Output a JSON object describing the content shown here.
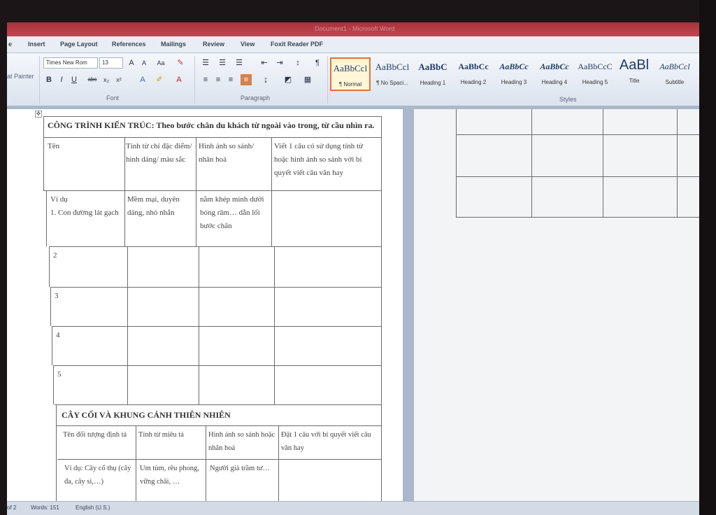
{
  "app": {
    "title": "Document1 - Microsoft Word"
  },
  "tabs": [
    "e",
    "Insert",
    "Page Layout",
    "References",
    "Mailings",
    "Review",
    "View",
    "Foxit Reader PDF"
  ],
  "ribbon": {
    "clipboard_label": "at Painter",
    "font_name": "Times New Rom",
    "font_size": "13",
    "font_group_label": "Font",
    "paragraph_group_label": "Paragraph",
    "styles_group_label": "Styles",
    "styles": [
      {
        "preview": "AaBbCcl",
        "name": "¶ Normal",
        "active": true
      },
      {
        "preview": "AaBbCcl",
        "name": "¶ No Spaci...",
        "active": false
      },
      {
        "preview": "AaBbC",
        "name": "Heading 1",
        "active": false
      },
      {
        "preview": "AaBbCc",
        "name": "Heading 2",
        "active": false
      },
      {
        "preview": "AaBbCc",
        "name": "Heading 3",
        "active": false
      },
      {
        "preview": "AaBbCc",
        "name": "Heading 4",
        "active": false
      },
      {
        "preview": "AaBbCcC",
        "name": "Heading 5",
        "active": false
      },
      {
        "preview": "AaBl",
        "name": "Title",
        "active": false
      },
      {
        "preview": "AaBbCcl",
        "name": "Subtitle",
        "active": false
      }
    ]
  },
  "document": {
    "section1_title": "CÔNG TRÌNH KIẾN TRÚC: Theo bước chân du khách từ ngoài vào trong, từ cầu nhìn ra.",
    "table1_headers": [
      "Tên",
      "Tính từ chỉ đặc điểm/ hình dáng/ màu sắc",
      "Hình ảnh so sánh/ nhân hoá",
      "Viết 1 câu có sử dụng tính từ hoặc hình ảnh so sánh với bí quyết viết câu văn hay"
    ],
    "table1_rows": [
      [
        "Ví dụ\n1. Con đường lát gạch",
        "Mềm mại, duyên dáng, nhỏ nhắn",
        "nằm khép mình dưới bóng râm… dẫn lối bước chân",
        ""
      ],
      [
        "2",
        "",
        "",
        ""
      ],
      [
        "3",
        "",
        "",
        ""
      ],
      [
        "4",
        "",
        "",
        ""
      ],
      [
        "5",
        "",
        "",
        ""
      ]
    ],
    "section2_title": "CÂY CỐI VÀ KHUNG CẢNH THIÊN NHIÊN",
    "table2_headers": [
      "Tên đối tượng định tả",
      "Tính từ miêu tả",
      "Hình ảnh so sánh hoặc nhân hoá",
      "Đặt 1 câu với bí quyết viết câu văn hay"
    ],
    "table2_rows": [
      [
        "Ví dụ: Cây cổ thụ (cây đa, cây si,…)",
        "Um tùm, rêu phong, vững chãi, …",
        "Người già trầm tư…",
        ""
      ]
    ]
  },
  "status": {
    "page": "of 2",
    "words": "Words: 151",
    "language": "English (U.S.)"
  }
}
